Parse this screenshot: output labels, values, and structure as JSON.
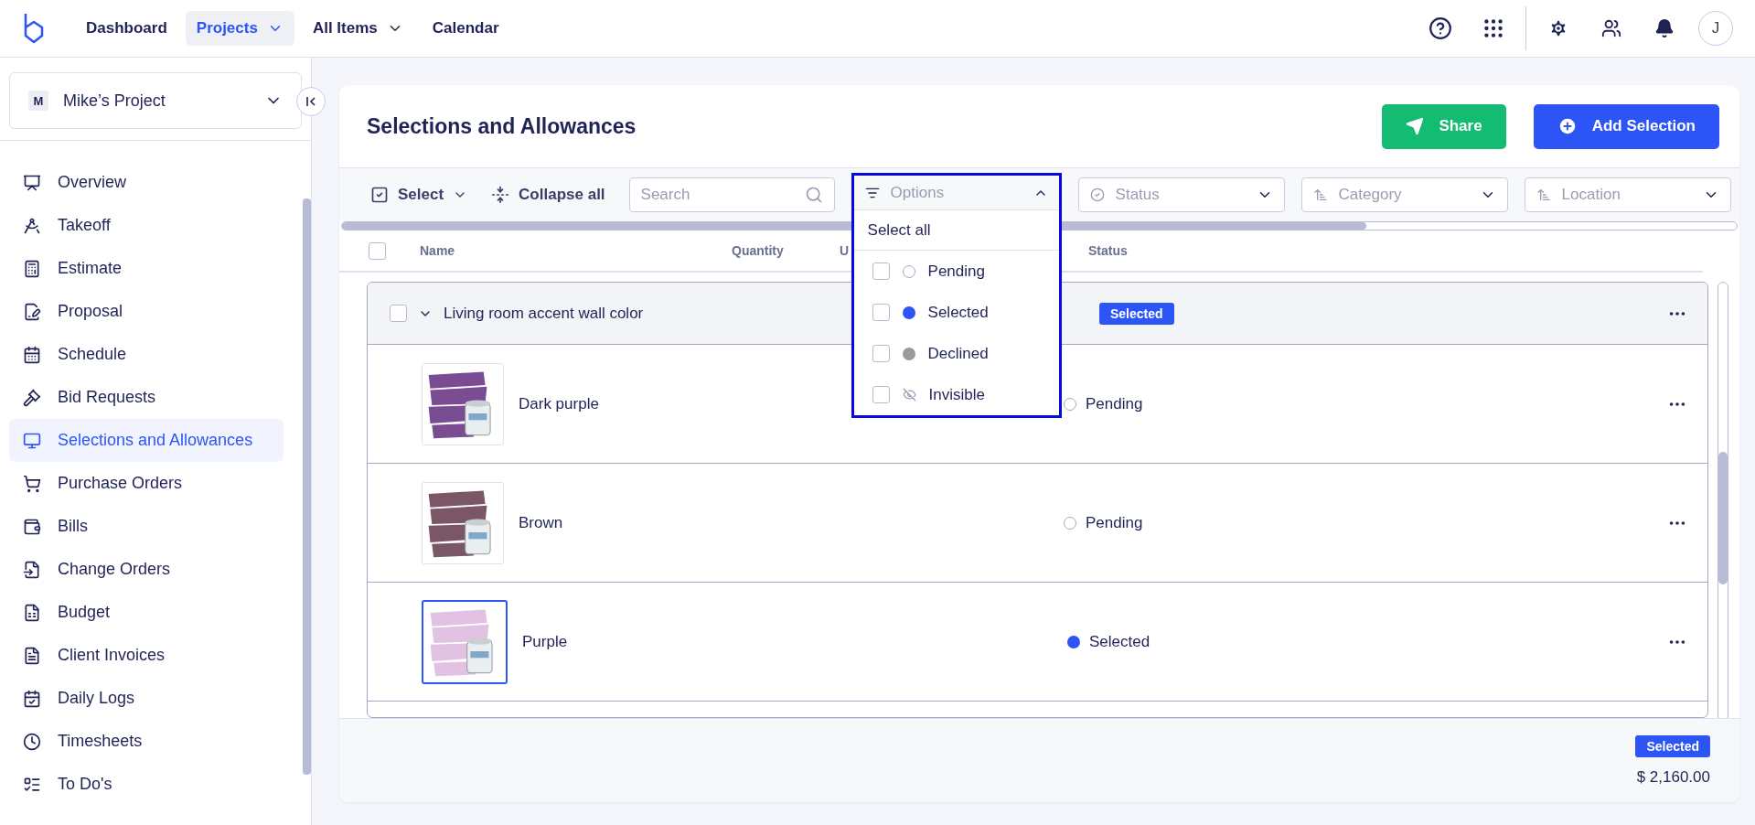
{
  "topnav": {
    "items": [
      {
        "label": "Dashboard",
        "selected": false,
        "dropdown": false
      },
      {
        "label": "Projects",
        "selected": true,
        "dropdown": true
      },
      {
        "label": "All Items",
        "selected": false,
        "dropdown": true
      },
      {
        "label": "Calendar",
        "selected": false,
        "dropdown": false
      }
    ],
    "avatar": "J"
  },
  "sidebar": {
    "project": {
      "initial": "M",
      "name": "Mike’s Project"
    },
    "items": [
      {
        "label": "Overview",
        "selected": false
      },
      {
        "label": "Takeoff",
        "selected": false
      },
      {
        "label": "Estimate",
        "selected": false
      },
      {
        "label": "Proposal",
        "selected": false
      },
      {
        "label": "Schedule",
        "selected": false
      },
      {
        "label": "Bid Requests",
        "selected": false
      },
      {
        "label": "Selections and Allowances",
        "selected": true
      },
      {
        "label": "Purchase Orders",
        "selected": false
      },
      {
        "label": "Bills",
        "selected": false
      },
      {
        "label": "Change Orders",
        "selected": false
      },
      {
        "label": "Budget",
        "selected": false
      },
      {
        "label": "Client Invoices",
        "selected": false
      },
      {
        "label": "Daily Logs",
        "selected": false
      },
      {
        "label": "Timesheets",
        "selected": false
      },
      {
        "label": "To Do's",
        "selected": false
      }
    ]
  },
  "page": {
    "title": "Selections and Allowances",
    "buttons": [
      {
        "label": "Share",
        "kind": "share"
      },
      {
        "label": "Add Selection",
        "kind": "add"
      }
    ]
  },
  "toolbar": {
    "select": "Select",
    "collapse": "Collapse all",
    "search": {
      "placeholder": "Search"
    },
    "options": {
      "placeholder": "Options",
      "expanded": true,
      "select_all": "Select all",
      "items": [
        {
          "label": "Pending",
          "kind": "pending",
          "checked": false
        },
        {
          "label": "Selected",
          "kind": "selected",
          "checked": false
        },
        {
          "label": "Declined",
          "kind": "declined",
          "checked": false
        },
        {
          "label": "Invisible",
          "kind": "invisible",
          "checked": false
        }
      ]
    },
    "filters": [
      {
        "placeholder": "Status",
        "kind": "status"
      },
      {
        "placeholder": "Category",
        "kind": "sort"
      },
      {
        "placeholder": "Location",
        "kind": "sort"
      }
    ]
  },
  "table": {
    "all_checked": false,
    "columns": [
      "Name",
      "Quantity",
      "U",
      "Status"
    ],
    "group": {
      "name": "Living room accent wall color",
      "badge": "Selected",
      "expanded": true,
      "checked": false
    },
    "rows": [
      {
        "name": "Dark purple",
        "status": "Pending",
        "kind": "pending",
        "selected": false
      },
      {
        "name": "Brown",
        "status": "Pending",
        "kind": "pending",
        "selected": false
      },
      {
        "name": "Purple",
        "status": "Selected",
        "kind": "selected",
        "selected": true
      }
    ]
  },
  "footer": {
    "badge": "Selected",
    "total": "$ 2,160.00"
  }
}
